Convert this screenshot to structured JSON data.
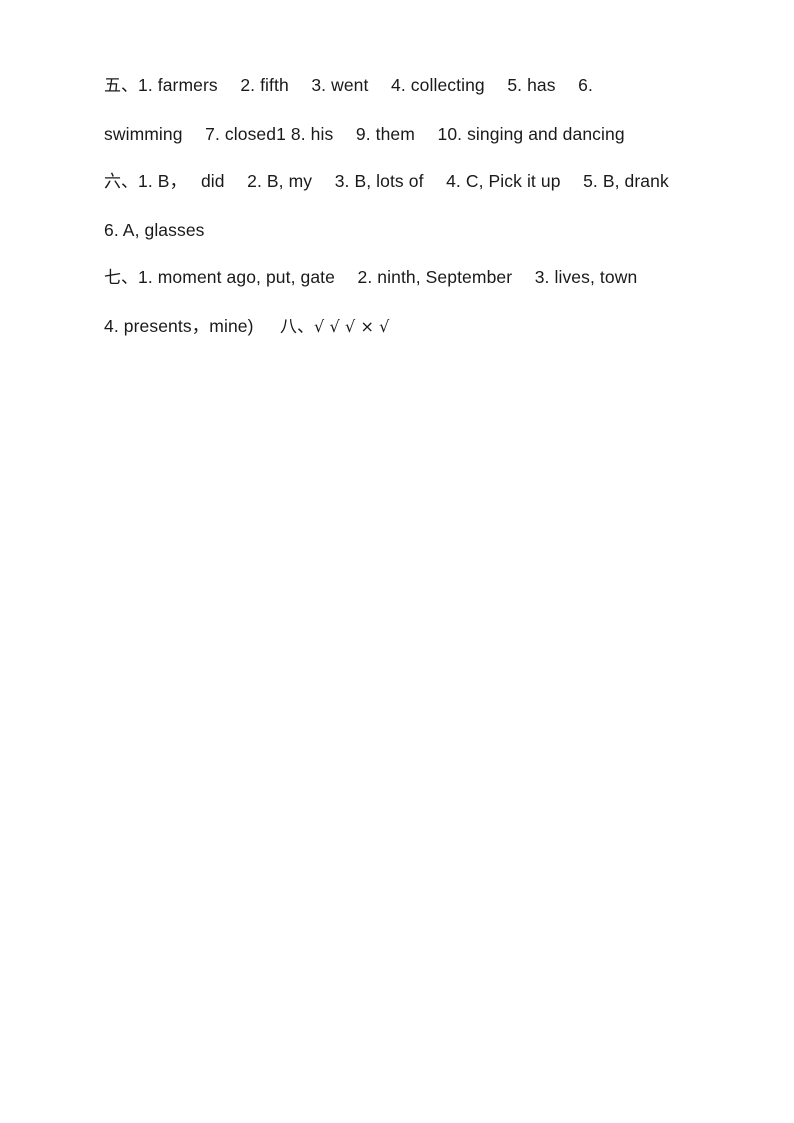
{
  "document": {
    "type": "answer-key",
    "page_background": "#ffffff",
    "text_color": "#1a1a1a",
    "sections": [
      {
        "id": "section-5",
        "marker": "五、",
        "lines": [
          "1. farmers  2. fifth  3. went  4. collecting  5. has  6.",
          "swimming  7. closed1 8. his  9. them  10. singing and dancing"
        ]
      },
      {
        "id": "section-6",
        "marker": "六、",
        "lines": [
          "1. B，  did  2. B, my  3. B, lots of  4. C, Pick it up  5. B, drank",
          "6. A, glasses"
        ]
      },
      {
        "id": "section-7",
        "marker": "七、",
        "lines": [
          "1. moment ago, put, gate  2. ninth, September  3. lives, town",
          "4. presents，mine)"
        ]
      },
      {
        "id": "section-8",
        "marker": "八、",
        "marks": "√ √ √ × √"
      }
    ],
    "line1_marker": "五、",
    "line1_text": "1. farmers  2. fifth  3. went  4. collecting  5. has  6.",
    "line2_text": "swimming  7. closed1 8. his  9. them  10. singing and dancing",
    "line3_marker": "六、",
    "line3_text": "1. B，  did  2. B, my  3. B, lots of  4. C, Pick it up  5. B, drank",
    "line4_text": "6. A, glasses",
    "line5_marker": "七、",
    "line5_text": "1. moment ago, put, gate  2. ninth, September  3. lives, town",
    "line6_text": "4. presents，mine)  ",
    "line6_marker": "八、",
    "line6_marks": "√ √ √ × √"
  }
}
